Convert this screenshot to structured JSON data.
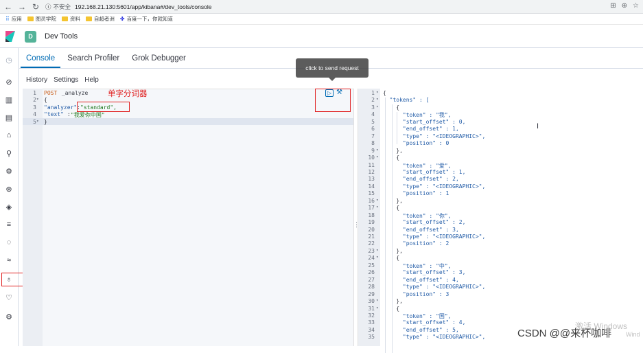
{
  "browser": {
    "insecure_label": "不安全",
    "url": "192.168.21.130:5601/app/kibana#/dev_tools/console",
    "bookmarks": [
      "应用",
      "图灵学院",
      "资料",
      "自超者洲",
      "百度一下，你就知道"
    ]
  },
  "app": {
    "avatar_letter": "D",
    "title": "Dev Tools"
  },
  "tabs": [
    {
      "label": "Console",
      "active": true
    },
    {
      "label": "Search Profiler",
      "active": false
    },
    {
      "label": "Grok Debugger",
      "active": false
    }
  ],
  "subnav": [
    "History",
    "Settings",
    "Help"
  ],
  "tooltip": "click to send request",
  "annotation": "单字分词器",
  "request": {
    "line_numbers": [
      "1",
      "2",
      "3",
      "4",
      "5"
    ],
    "line1_method": "POST",
    "line1_path": " _analyze",
    "line2": "{",
    "line3_key": "\"analyzer\"",
    "line3_colon": ":",
    "line3_value": "\"standard\",",
    "line4_key": "\"text\"",
    "line4_colon": ":",
    "line4_value": "\"我爱你中国\"",
    "line5": "}"
  },
  "response": {
    "lines": [
      {
        "n": "1",
        "text": "{"
      },
      {
        "n": "2",
        "text": "  \"tokens\" : ["
      },
      {
        "n": "3",
        "text": "    {"
      },
      {
        "n": "4",
        "text": "      \"token\" : \"我\","
      },
      {
        "n": "5",
        "text": "      \"start_offset\" : 0,"
      },
      {
        "n": "6",
        "text": "      \"end_offset\" : 1,"
      },
      {
        "n": "7",
        "text": "      \"type\" : \"<IDEOGRAPHIC>\","
      },
      {
        "n": "8",
        "text": "      \"position\" : 0"
      },
      {
        "n": "9",
        "text": "    },"
      },
      {
        "n": "10",
        "text": "    {"
      },
      {
        "n": "11",
        "text": "      \"token\" : \"爱\","
      },
      {
        "n": "12",
        "text": "      \"start_offset\" : 1,"
      },
      {
        "n": "13",
        "text": "      \"end_offset\" : 2,"
      },
      {
        "n": "14",
        "text": "      \"type\" : \"<IDEOGRAPHIC>\","
      },
      {
        "n": "15",
        "text": "      \"position\" : 1"
      },
      {
        "n": "16",
        "text": "    },"
      },
      {
        "n": "17",
        "text": "    {"
      },
      {
        "n": "18",
        "text": "      \"token\" : \"你\","
      },
      {
        "n": "19",
        "text": "      \"start_offset\" : 2,"
      },
      {
        "n": "20",
        "text": "      \"end_offset\" : 3,"
      },
      {
        "n": "21",
        "text": "      \"type\" : \"<IDEOGRAPHIC>\","
      },
      {
        "n": "22",
        "text": "      \"position\" : 2"
      },
      {
        "n": "23",
        "text": "    },"
      },
      {
        "n": "24",
        "text": "    {"
      },
      {
        "n": "25",
        "text": "      \"token\" : \"中\","
      },
      {
        "n": "26",
        "text": "      \"start_offset\" : 3,"
      },
      {
        "n": "27",
        "text": "      \"end_offset\" : 4,"
      },
      {
        "n": "28",
        "text": "      \"type\" : \"<IDEOGRAPHIC>\","
      },
      {
        "n": "29",
        "text": "      \"position\" : 3"
      },
      {
        "n": "30",
        "text": "    },"
      },
      {
        "n": "31",
        "text": "    {"
      },
      {
        "n": "32",
        "text": "      \"token\" : \"国\","
      },
      {
        "n": "33",
        "text": "      \"start_offset\" : 4,"
      },
      {
        "n": "34",
        "text": "      \"end_offset\" : 5,"
      },
      {
        "n": "35",
        "text": "      \"type\" : \"<IDEOGRAPHIC>\","
      }
    ]
  },
  "watermark": "CSDN @@来杯咖啡",
  "windows_watermark": "激活 Windows",
  "windows_watermark_tail": "Wind"
}
